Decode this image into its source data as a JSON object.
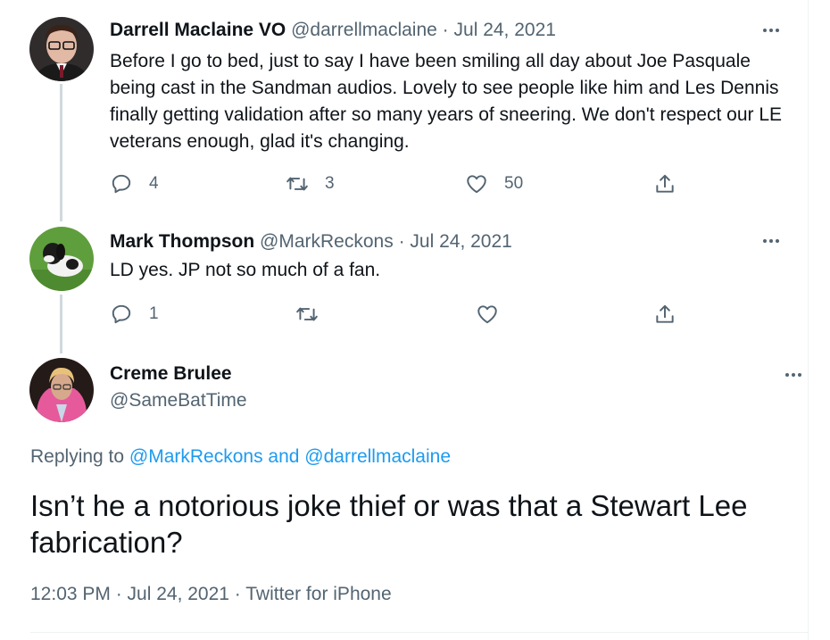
{
  "tweets": [
    {
      "name": "Darrell Maclaine VO",
      "handle": "@darrellmaclaine",
      "separator": "·",
      "date": "Jul 24, 2021",
      "text": "Before I go to bed, just to say I have been smiling all day about Joe Pasquale being cast in the Sandman audios. Lovely to see people like him and Les Dennis finally getting validation after so many years of sneering. We don't respect our LE veterans enough, glad it's changing.",
      "replies": "4",
      "retweets": "3",
      "likes": "50"
    },
    {
      "name": "Mark Thompson",
      "handle": "@MarkReckons",
      "separator": "·",
      "date": "Jul 24, 2021",
      "text": "LD yes. JP not so much of a fan.",
      "replies": "1",
      "retweets": "",
      "likes": ""
    }
  ],
  "focused": {
    "name": "Creme Brulee",
    "handle": "@SameBatTime",
    "replying_prefix": "Replying to ",
    "replying_to": "@MarkReckons and @darrellmaclaine",
    "text": "Isn’t he a notorious joke thief or was that a Stewart Lee fabrication?",
    "timestamp": "12:03 PM · Jul 24, 2021 · Twitter for iPhone"
  },
  "icons": {
    "reply": "reply-icon",
    "retweet": "retweet-icon",
    "like": "heart-icon",
    "share": "share-icon",
    "more": "more-icon"
  },
  "colors": {
    "link": "#1d9bf0",
    "secondary": "#536471",
    "text": "#0f1419",
    "thread_line": "#cfd9de"
  }
}
